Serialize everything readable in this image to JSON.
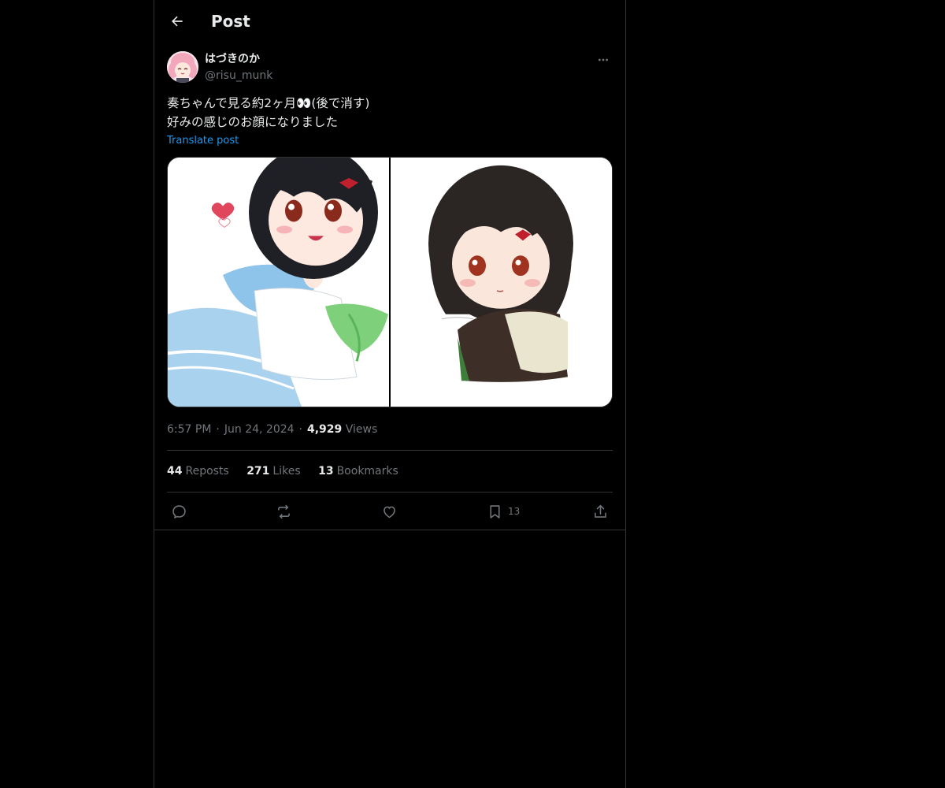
{
  "header": {
    "title": "Post"
  },
  "author": {
    "display_name": "はづきのか",
    "handle": "@risu_munk"
  },
  "tweet": {
    "lines": [
      "奏ちゃんで見る約2ヶ月👀(後で消す)",
      "好みの感じのお顔になりました"
    ],
    "translate_label": "Translate post"
  },
  "meta": {
    "time": "6:57 PM",
    "date": "Jun 24, 2024",
    "views_count": "4,929",
    "views_label": "Views"
  },
  "stats": {
    "reposts_count": "44",
    "reposts_label": "Reposts",
    "likes_count": "271",
    "likes_label": "Likes",
    "bookmarks_count": "13",
    "bookmarks_label": "Bookmarks"
  },
  "actions": {
    "bookmark_count": "13"
  },
  "colors": {
    "background": "#000000",
    "text": "#e7e9ea",
    "muted": "#71767b",
    "accent": "#1d9bf0",
    "border": "#2f3336"
  },
  "icons": [
    "arrow-left-icon",
    "more-icon",
    "reply-icon",
    "repost-icon",
    "like-icon",
    "bookmark-icon",
    "share-icon"
  ]
}
